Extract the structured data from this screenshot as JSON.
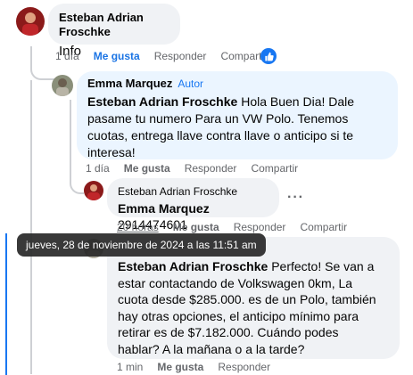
{
  "comments": [
    {
      "author": "Esteban Adrian Froschke",
      "text": "Info",
      "time": "1 día",
      "like": "Me gusta",
      "reply": "Responder",
      "share": "Compartir"
    },
    {
      "author": "Emma Marquez",
      "badge": "Autor",
      "tag": "Esteban Adrian Froschke",
      "text_lines": [
        " Hola Buen Dia! Dale",
        "pasame tu numero Para un VW Polo. Tenemos",
        "cuotas, entrega llave contra llave o anticipo si te",
        "interesa!"
      ],
      "time": "1 día",
      "like": "Me gusta",
      "reply": "Responder",
      "share": "Compartir"
    },
    {
      "author": "Esteban Adrian Froschke",
      "tag": "Emma Marquez",
      "text": " 2914474601",
      "more": "···",
      "time": "20 horas",
      "like": "Me gusta",
      "reply": "Responder",
      "share": "Compartir"
    },
    {
      "tag": "Esteban Adrian Froschke",
      "text_lines": [
        " Perfecto! Se van a",
        "estar contactando de Volkswagen 0km, La",
        "cuota desde $285.000. es de un Polo, también",
        "hay otras opciones, el anticipo mínimo para",
        "retirar es de $7.182.000. Cuándo podes",
        "hablar? A la mañana o a la tarde?"
      ],
      "time": "1 min",
      "like": "Me gusta",
      "reply": "Responder"
    }
  ],
  "tooltip": "jueves, 28 de noviembre de 2024 a las 11:51 am",
  "icons": {
    "like_badge": "thumbs-up-icon",
    "more": "more-options-icon"
  },
  "colors": {
    "accent": "#1877f2",
    "bubble": "#f0f2f5",
    "highlight": "#ebf5ff",
    "secondary_text": "#65676b"
  }
}
